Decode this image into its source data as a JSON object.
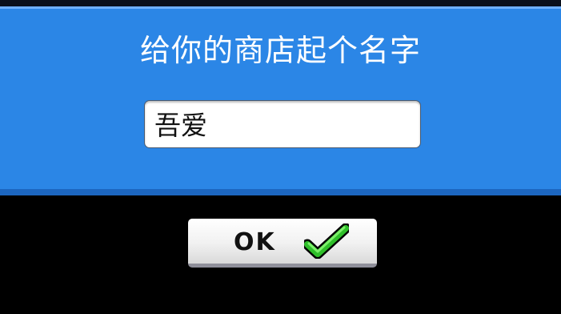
{
  "dialog": {
    "title": "给你的商店起个名字",
    "store_name_value": "吾爱",
    "panel_color": "#2b86e6"
  },
  "ok_button": {
    "label": "OK",
    "icon": "check-icon",
    "icon_color": "#3fd93a"
  }
}
